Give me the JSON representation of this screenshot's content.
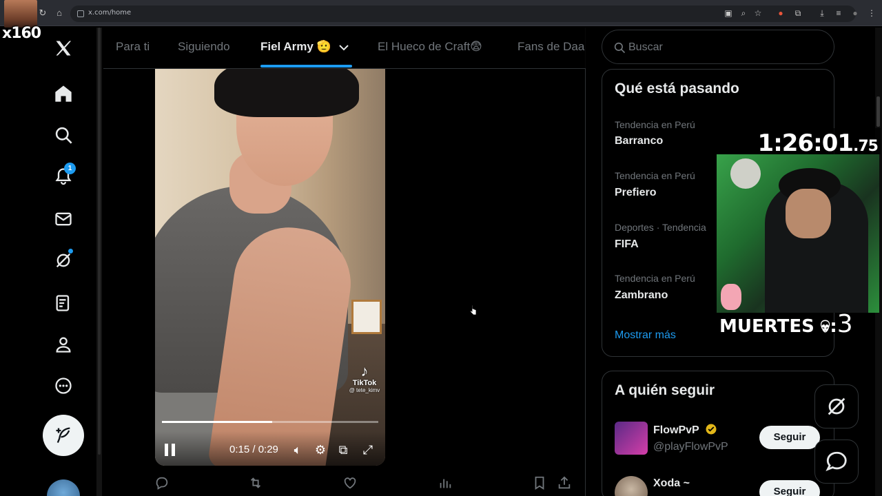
{
  "browser": {
    "url": "x.com/home"
  },
  "overlay": {
    "multiplier": "x160",
    "timer_main": "1:26:01",
    "timer_fraction": ".75",
    "deaths_label": "MUERTES",
    "deaths_count": "3"
  },
  "nav": {
    "notifications_count": "1"
  },
  "tabs": [
    {
      "label": "Para ti"
    },
    {
      "label": "Siguiendo"
    },
    {
      "label": "Fiel Army 🫡",
      "active": true
    },
    {
      "label": "El Hueco de Craft😨"
    },
    {
      "label": "Fans de Daa"
    }
  ],
  "video": {
    "time": "0:15 / 0:29",
    "progress": 0.51,
    "watermark_brand": "TikTok",
    "watermark_handle": "@ tete_kimv"
  },
  "search": {
    "placeholder": "Buscar"
  },
  "trends": {
    "title": "Qué está pasando",
    "items": [
      {
        "meta": "Tendencia en Perú",
        "name": "Barranco"
      },
      {
        "meta": "Tendencia en Perú",
        "name": "Prefiero"
      },
      {
        "meta": "Deportes · Tendencia",
        "name": "FIFA"
      },
      {
        "meta": "Tendencia en Perú",
        "name": "Zambrano"
      }
    ],
    "show_more": "Mostrar más"
  },
  "who_to_follow": {
    "title": "A quién seguir",
    "items": [
      {
        "name": "FlowPvP",
        "handle": "@playFlowPvP",
        "button": "Seguir"
      },
      {
        "name": "Xoda ~",
        "handle": "",
        "button": "Seguir"
      }
    ]
  },
  "colors": {
    "accent": "#1d9bf0",
    "background": "#000000",
    "muted": "#71767b"
  }
}
